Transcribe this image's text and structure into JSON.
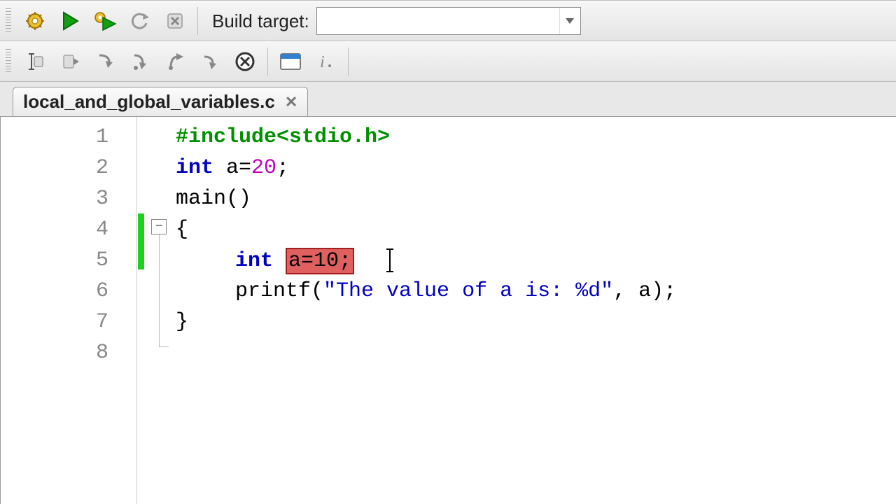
{
  "toolbar": {
    "build_target_label": "Build target:",
    "build_target_value": ""
  },
  "tab": {
    "title": "local_and_global_variables.c"
  },
  "editor": {
    "lines": [
      "1",
      "2",
      "3",
      "4",
      "5",
      "6",
      "7",
      "8"
    ],
    "line1": {
      "include": "#include",
      "header": "<stdio.h>"
    },
    "line2": {
      "kw": "int",
      "var": " a=",
      "num": "20",
      "semi": ";"
    },
    "line3": {
      "fn": "main",
      "parens": "()"
    },
    "line4": {
      "brace": "{"
    },
    "line5": {
      "kw": "int ",
      "hl": "a=10;"
    },
    "line6": {
      "fn": "printf(",
      "str": "\"The value of a is: %d\"",
      "rest": ", a);"
    },
    "line7": {
      "brace": "}"
    }
  },
  "icons": {
    "gear": "gear",
    "play": "play",
    "play_gear": "play-gear",
    "refresh": "refresh",
    "stop": "stop",
    "fold_minus": "−"
  }
}
